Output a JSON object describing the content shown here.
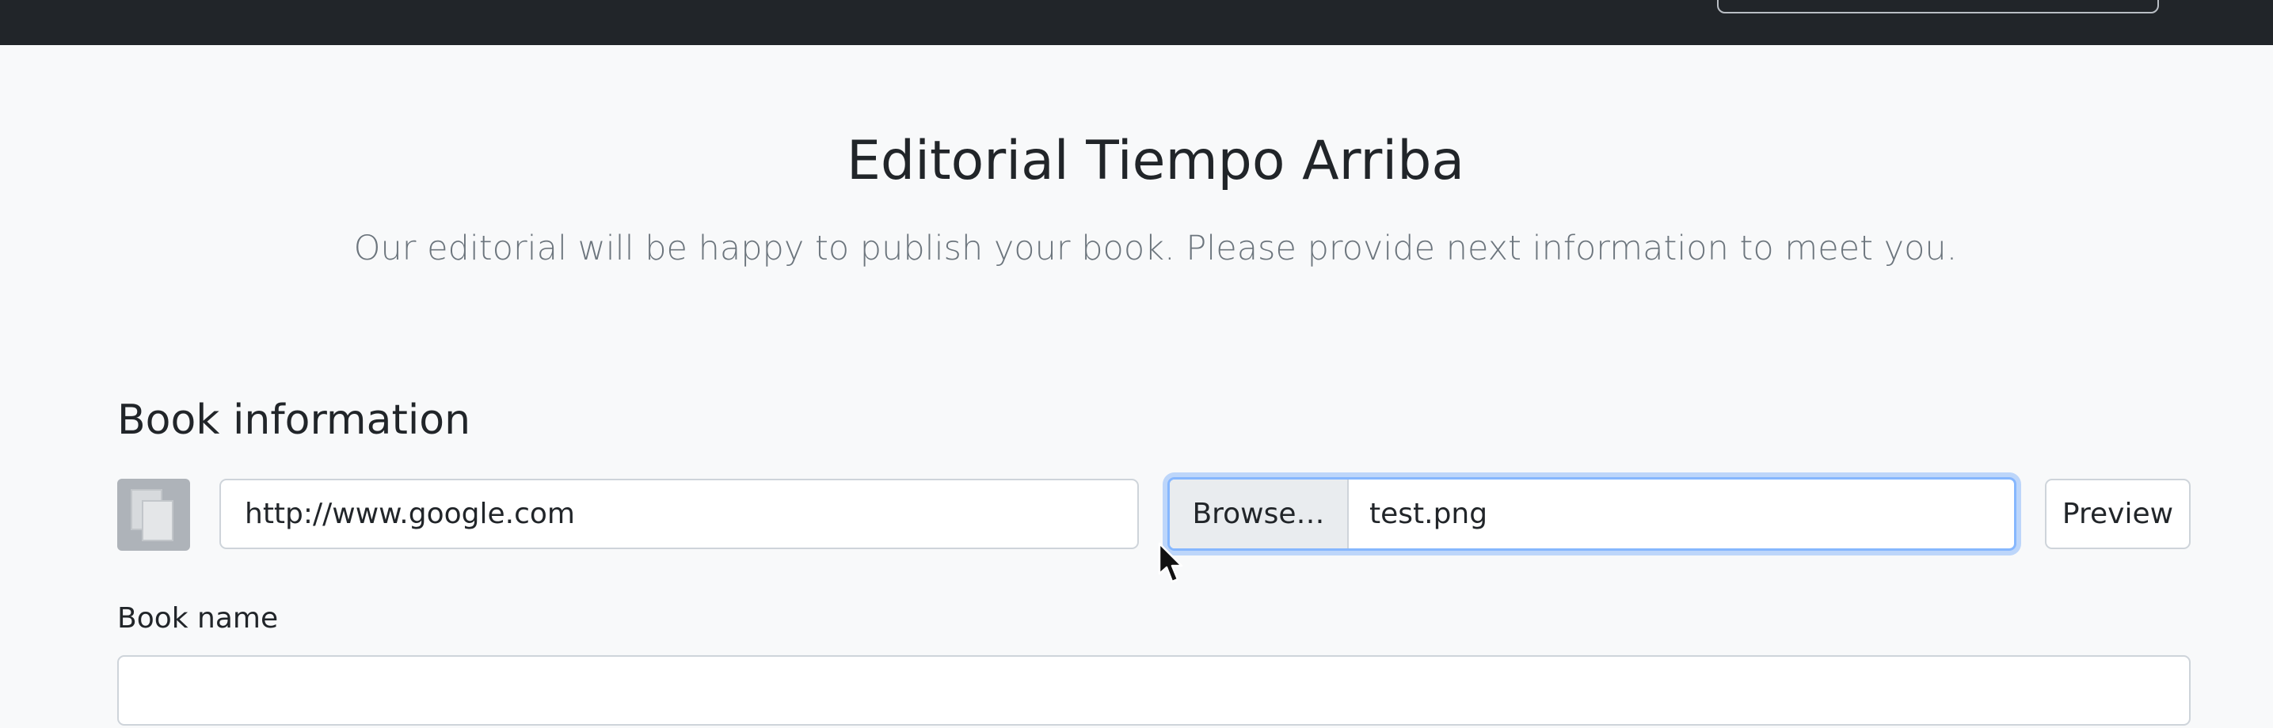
{
  "page": {
    "title": "Editorial Tiempo Arriba",
    "subtitle": "Our editorial will be happy to publish your book. Please provide next information to meet you."
  },
  "book_section": {
    "heading": "Book information",
    "cover_icon": "image-placeholder-icon",
    "url_input": {
      "value": "http://www.google.com"
    },
    "file_input": {
      "browse_label": "Browse…",
      "file_name": "test.png"
    },
    "preview_label": "Preview",
    "book_name": {
      "label": "Book name",
      "value": ""
    }
  },
  "colors": {
    "navbar": "#212529",
    "background": "#f8f9fa",
    "focus_border": "#86b7fe"
  }
}
